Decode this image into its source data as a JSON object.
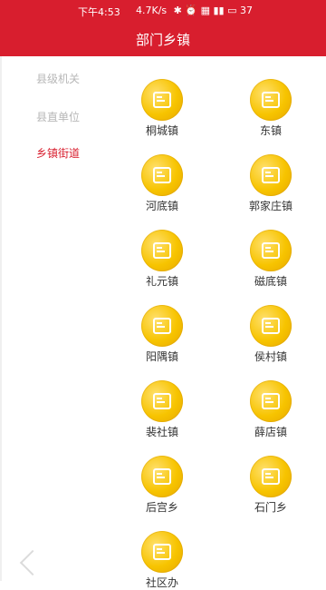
{
  "status_bar": {
    "time": "下午4:53",
    "right": "4.7K/s",
    "battery_percent": "37"
  },
  "header": {
    "title": "部门乡镇"
  },
  "sidebar": {
    "items": [
      {
        "label": "县级机关",
        "active": false
      },
      {
        "label": "县直单位",
        "active": false
      },
      {
        "label": "乡镇街道",
        "active": true
      }
    ]
  },
  "towns": [
    {
      "label": "桐城镇"
    },
    {
      "label": "东镇"
    },
    {
      "label": "河底镇"
    },
    {
      "label": "郭家庄镇"
    },
    {
      "label": "礼元镇"
    },
    {
      "label": "磁底镇"
    },
    {
      "label": "阳隅镇"
    },
    {
      "label": "侯村镇"
    },
    {
      "label": "裴社镇"
    },
    {
      "label": "薛店镇"
    },
    {
      "label": "后宫乡"
    },
    {
      "label": "石门乡"
    },
    {
      "label": "社区办"
    }
  ],
  "colors": {
    "brand_red": "#d81e2e",
    "coin_gold": "#f7c400",
    "sidebar_text": "#b7b7b7"
  }
}
